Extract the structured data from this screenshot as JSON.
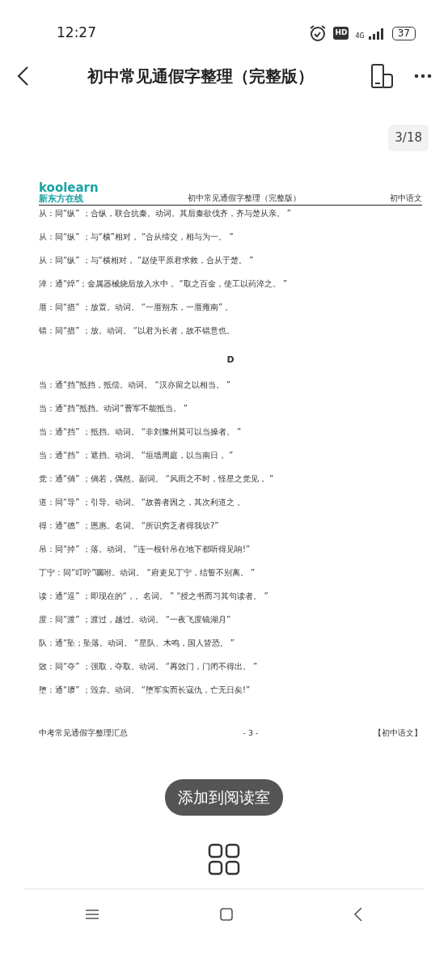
{
  "status_bar": {
    "time": "12:27",
    "hd": "HD",
    "network": "4G",
    "battery": "37"
  },
  "toolbar": {
    "title": "初中常见通假字整理（完整版）"
  },
  "page_indicator": "3/18",
  "document": {
    "logo": {
      "brand": "koolearn",
      "subtitle": "新东方在线"
    },
    "header_title": "初中常见通假字整理（完整版）",
    "header_subject": "初中语文",
    "entries": [
      {
        "kind": "line",
        "text": "从：同“纵” ；合纵，联合抗秦。动词。其后秦欲伐齐，齐与楚从亲。 ”"
      },
      {
        "kind": "line",
        "text": "从：同“纵” ；与“横”相对， “合从缔交，相与为一。 ”"
      },
      {
        "kind": "line",
        "text": "从：同“纵” ；与“横相对， “赵使平原君求救，合从于楚。 ”"
      },
      {
        "kind": "line",
        "text": "淬：通“焠”；金属器械烧后放入水中， “取之百金，使工以药淬之。 ”"
      },
      {
        "kind": "line",
        "text": "厝：同“措” ；放置。动词。 “一厝朔东，一厝雍南” 。"
      },
      {
        "kind": "line",
        "text": "错：同“措” ；放。动词。 “以君为长者，故不错意也。"
      },
      {
        "kind": "heading",
        "text": "D"
      },
      {
        "kind": "line",
        "text": "当：通“挡”抵挡，抵偿。动词。 “汉亦留之以相当。 ”"
      },
      {
        "kind": "line",
        "text": "当：通“挡”抵挡。动词“曹军不能抵当。 ”"
      },
      {
        "kind": "line",
        "text": "当：通“挡” ；抵挡。动词。 “非刘豫州莫可以当操者。 ”"
      },
      {
        "kind": "line",
        "text": "当：通“挡” ；遮挡。动词。 “垣墙周庭，以当南日， ”"
      },
      {
        "kind": "line",
        "text": "党：通“倘” ；倘若，偶然。副词。 “风雨之不时，怪星之党见， ”"
      },
      {
        "kind": "line",
        "text": "道：同“导” ；引导。动词。 “故善者因之，其次利道之 。"
      },
      {
        "kind": "line",
        "text": "得：通“德” ；恩惠。名词。 “所识穷乏者得我欤?”"
      },
      {
        "kind": "line",
        "text": "吊：同“掉” ；落。动词。 “连一根针吊在地下都听得见响!”"
      },
      {
        "kind": "line",
        "text": "丁宁：同“叮咛”嘱咐。动词。 “府吏见丁宁，结誓不别离。 ”"
      },
      {
        "kind": "line",
        "text": "读：通“逗” ；即现在的“，。名词。 ” “授之书而习其句读者。 ”"
      },
      {
        "kind": "line",
        "text": "度：同“渡” ；渡过，越过。动词。 “一夜飞度镜湖月”"
      },
      {
        "kind": "line",
        "text": "队：通“坠；坠落。动词。 “星队、木鸣，国人皆恐。 ”"
      },
      {
        "kind": "line",
        "text": "敚：同“夺” ；强取，夺取。动词。 “再敚门，门闭不得出。 ”"
      },
      {
        "kind": "line",
        "text": "堕：通“隳” ；毁弃。动词。 “堕军实而长寇仇，亡无日矣!”"
      }
    ],
    "footer": {
      "left": "中考常见通假字整理汇总",
      "center": "- 3 -",
      "right": "【初中语文】"
    }
  },
  "add_button": "添加到阅读室"
}
